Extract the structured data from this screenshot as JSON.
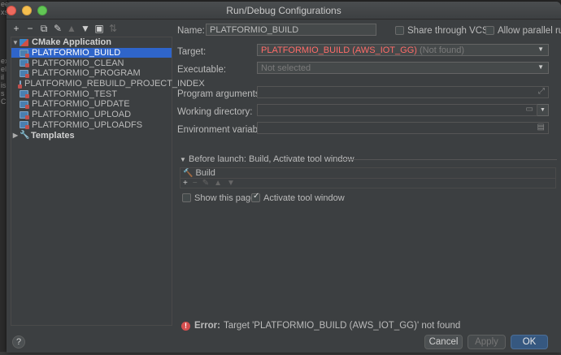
{
  "window": {
    "title": "Run/Debug Configurations"
  },
  "ide_strip": [
    "ee",
    "xs",
    "",
    "ex",
    "el",
    "il",
    "is",
    "s",
    "Ci"
  ],
  "toolbar": {
    "add": "+",
    "remove": "−",
    "copy": "⧉",
    "edit": "✎",
    "up": "▲",
    "down": "▼",
    "folder": "▣",
    "sort": "⇅"
  },
  "tree": {
    "group_label": "CMake Application",
    "items": [
      {
        "label": "PLATFORMIO_BUILD",
        "selected": true
      },
      {
        "label": "PLATFORMIO_CLEAN"
      },
      {
        "label": "PLATFORMIO_PROGRAM"
      },
      {
        "label": "PLATFORMIO_REBUILD_PROJECT_INDEX"
      },
      {
        "label": "PLATFORMIO_TEST"
      },
      {
        "label": "PLATFORMIO_UPDATE"
      },
      {
        "label": "PLATFORMIO_UPLOAD"
      },
      {
        "label": "PLATFORMIO_UPLOADFS"
      }
    ],
    "templates_label": "Templates"
  },
  "form": {
    "name_label": "Name:",
    "name_value": "PLATFORMIO_BUILD",
    "share_label": "Share through VCS",
    "parallel_label": "Allow parallel run",
    "target_label": "Target:",
    "target_value": "PLATFORMIO_BUILD (AWS_IOT_GG)",
    "target_status": "(Not found)",
    "executable_label": "Executable:",
    "executable_value": "Not selected",
    "program_args_label": "Program arguments:",
    "working_dir_label": "Working directory:",
    "env_vars_label": "Environment variables:"
  },
  "before_launch": {
    "header": "Before launch: Build, Activate tool window",
    "task": "Build",
    "show_page_label": "Show this page",
    "activate_label": "Activate tool window"
  },
  "error": {
    "prefix": "Error:",
    "message": "Target 'PLATFORMIO_BUILD (AWS_IOT_GG)' not found"
  },
  "buttons": {
    "help": "?",
    "cancel": "Cancel",
    "apply": "Apply",
    "ok": "OK"
  }
}
